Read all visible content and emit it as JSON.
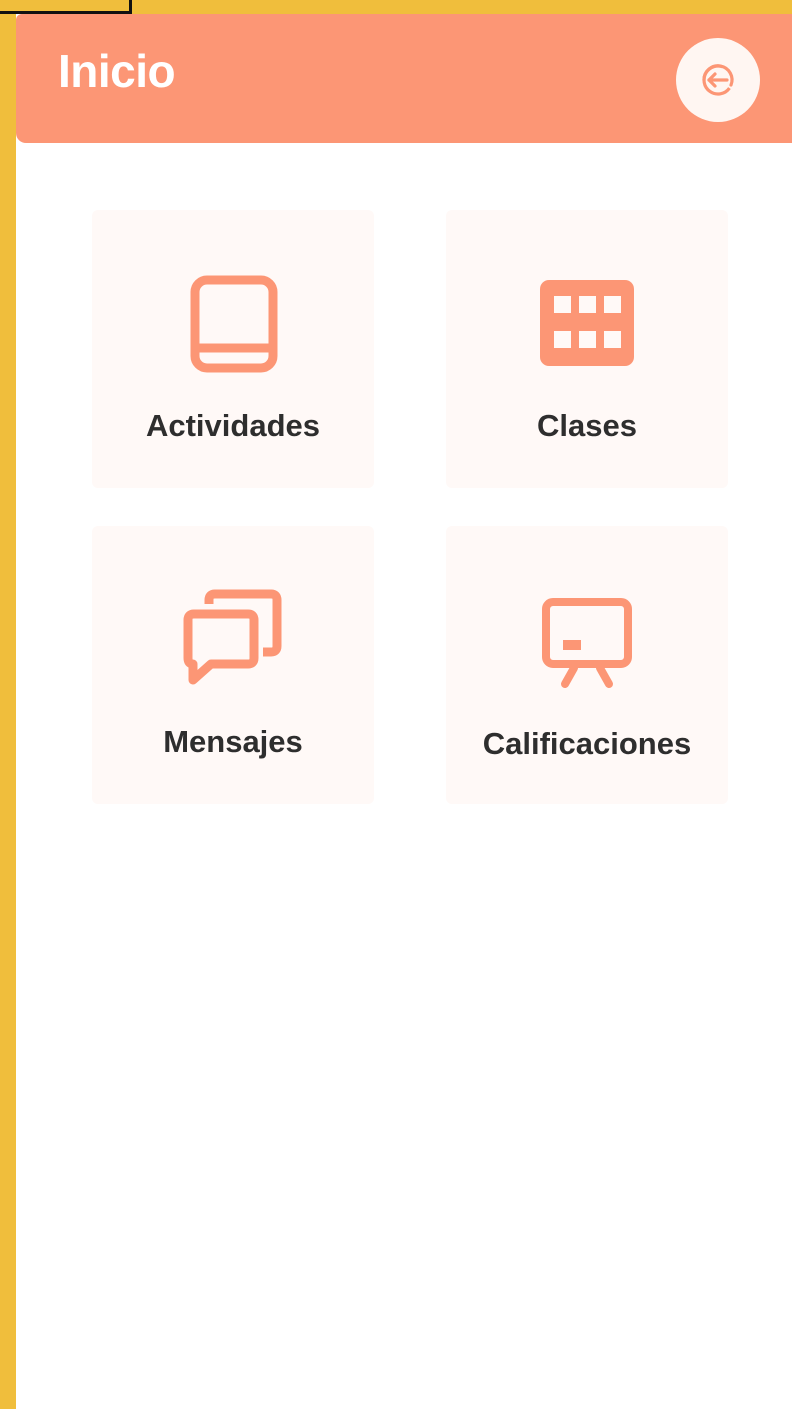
{
  "header": {
    "title": "Inicio",
    "logout_icon": "logout-icon"
  },
  "tiles": [
    {
      "label": "Actividades",
      "icon": "book-icon"
    },
    {
      "label": "Clases",
      "icon": "grid-icon"
    },
    {
      "label": "Mensajes",
      "icon": "chat-bubbles-icon"
    },
    {
      "label": "Calificaciones",
      "icon": "presentation-board-icon"
    }
  ],
  "colors": {
    "accent": "#FC9675",
    "tile_background": "#FFF9F7",
    "outer_background": "#F0BE3C",
    "text": "#2E2E2E"
  }
}
